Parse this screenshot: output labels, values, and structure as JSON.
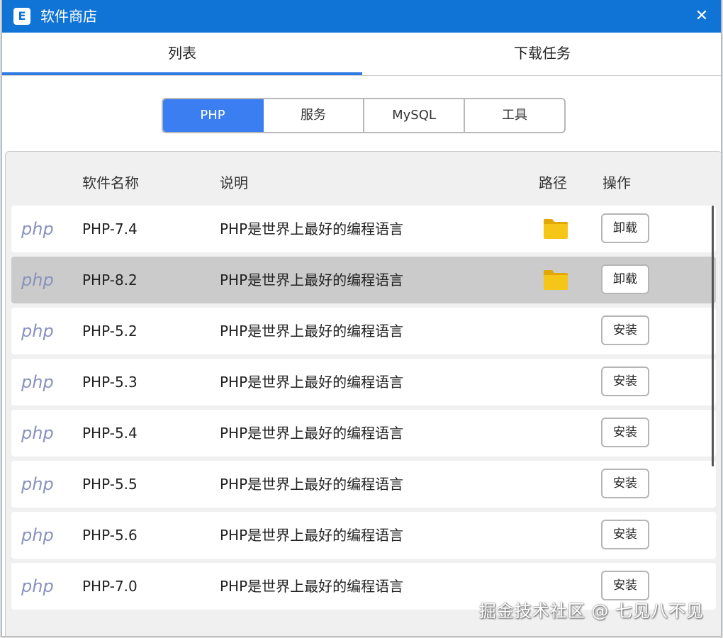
{
  "window": {
    "title": "软件商店",
    "app_icon_letter": "E",
    "close_label": "✕"
  },
  "main_tabs": [
    {
      "label": "列表",
      "active": true
    },
    {
      "label": "下载任务",
      "active": false
    }
  ],
  "categories": [
    {
      "label": "PHP",
      "active": true
    },
    {
      "label": "服务",
      "active": false
    },
    {
      "label": "MySQL",
      "active": false
    },
    {
      "label": "工具",
      "active": false
    }
  ],
  "table": {
    "headers": {
      "name": "软件名称",
      "desc": "说明",
      "path": "路径",
      "op": "操作"
    },
    "rows": [
      {
        "logo": "php",
        "name": "PHP-7.4",
        "desc": "PHP是世界上最好的编程语言",
        "has_folder": true,
        "action": "卸载",
        "selected": false
      },
      {
        "logo": "php",
        "name": "PHP-8.2",
        "desc": "PHP是世界上最好的编程语言",
        "has_folder": true,
        "action": "卸载",
        "selected": true
      },
      {
        "logo": "php",
        "name": "PHP-5.2",
        "desc": "PHP是世界上最好的编程语言",
        "has_folder": false,
        "action": "安装",
        "selected": false
      },
      {
        "logo": "php",
        "name": "PHP-5.3",
        "desc": "PHP是世界上最好的编程语言",
        "has_folder": false,
        "action": "安装",
        "selected": false
      },
      {
        "logo": "php",
        "name": "PHP-5.4",
        "desc": "PHP是世界上最好的编程语言",
        "has_folder": false,
        "action": "安装",
        "selected": false
      },
      {
        "logo": "php",
        "name": "PHP-5.5",
        "desc": "PHP是世界上最好的编程语言",
        "has_folder": false,
        "action": "安装",
        "selected": false
      },
      {
        "logo": "php",
        "name": "PHP-5.6",
        "desc": "PHP是世界上最好的编程语言",
        "has_folder": false,
        "action": "安装",
        "selected": false
      },
      {
        "logo": "php",
        "name": "PHP-7.0",
        "desc": "PHP是世界上最好的编程语言",
        "has_folder": false,
        "action": "安装",
        "selected": false
      }
    ]
  },
  "watermark": "掘金技术社区 @ 七见八不见",
  "colors": {
    "titlebar": "#1074d6",
    "accent": "#3a7ef2",
    "selected_row": "#cbcbcb",
    "folder": "#f5c518"
  }
}
